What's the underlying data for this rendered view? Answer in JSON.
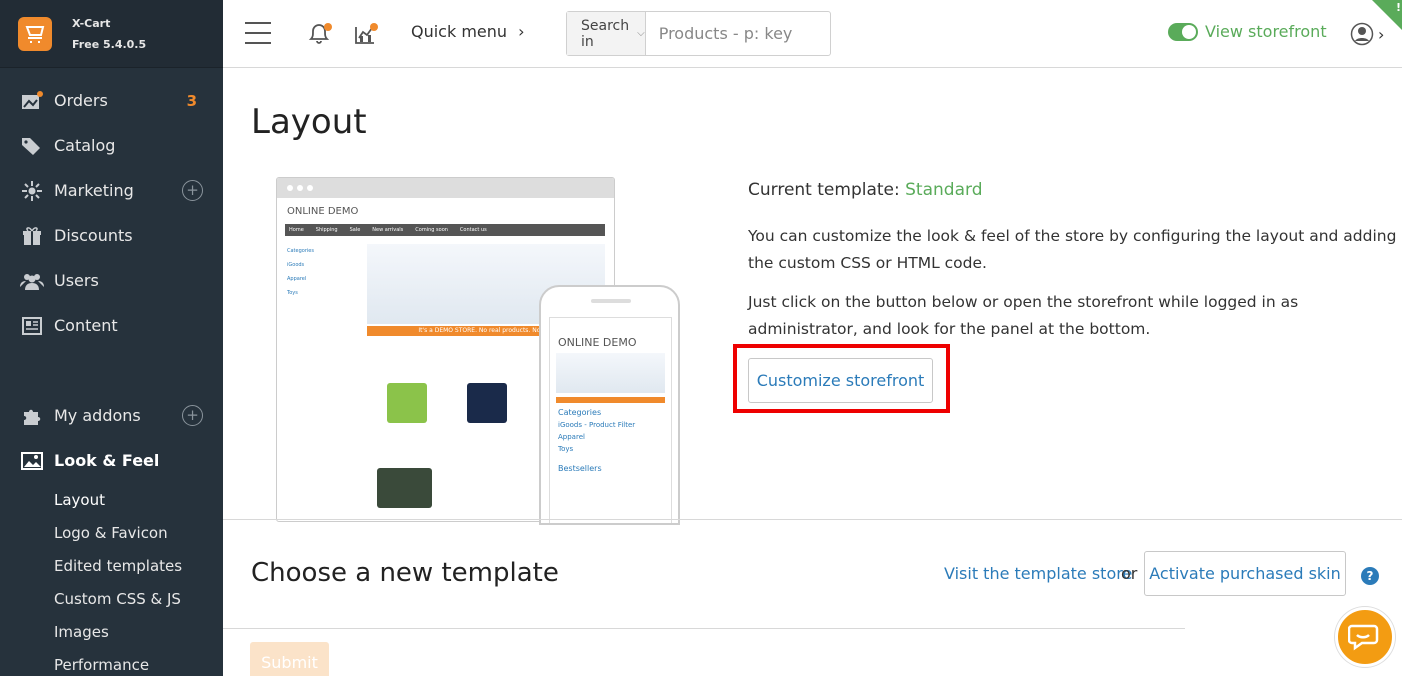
{
  "brand": {
    "name": "X-Cart",
    "version": "Free 5.4.0.5"
  },
  "sidebar": {
    "items": [
      {
        "label": "Orders",
        "badge": "3",
        "icon": "orders-icon"
      },
      {
        "label": "Catalog",
        "icon": "tag-icon"
      },
      {
        "label": "Marketing",
        "icon": "marketing-icon"
      },
      {
        "label": "Discounts",
        "icon": "gift-icon"
      },
      {
        "label": "Users",
        "icon": "users-icon"
      },
      {
        "label": "Content",
        "icon": "content-icon"
      },
      {
        "label": "My addons",
        "icon": "puzzle-icon"
      },
      {
        "label": "Look & Feel",
        "icon": "image-icon"
      }
    ],
    "sub_items": [
      "Layout",
      "Logo & Favicon",
      "Edited templates",
      "Custom CSS & JS",
      "Images",
      "Performance"
    ]
  },
  "topbar": {
    "quick_menu": "Quick menu",
    "search_in": "Search in",
    "search_placeholder": "Products - p: key",
    "view_storefront": "View storefront"
  },
  "main": {
    "title": "Layout",
    "current_template_label": "Current template:",
    "current_template_value": "Standard",
    "desc1": "You can customize the look & feel of the store by configuring the layout and adding the custom CSS or HTML code.",
    "desc2": "Just click on the button below or open the storefront while logged in as administrator, and look for the panel at the bottom.",
    "customize_button": "Customize storefront",
    "choose_title": "Choose a new template",
    "visit_link": "Visit the template store",
    "or": "or",
    "activate_button": "Activate purchased skin",
    "submit": "Submit"
  },
  "preview": {
    "desktop_logo": "ONLINE DEMO",
    "nav": [
      "Home",
      "Shipping",
      "Sale",
      "New arrivals",
      "Coming soon",
      "Contact us"
    ],
    "categories": [
      "Categories",
      "iGoods",
      "Apparel",
      "Toys"
    ],
    "strip": "It's a DEMO STORE. No real products. No real",
    "phone_logo": "ONLINE DEMO",
    "phone_categories": [
      "Categories",
      "iGoods - Product Filter",
      "Apparel",
      "Toys",
      "Bestsellers"
    ]
  },
  "colors": {
    "accent": "#f08a2c",
    "link": "#2b7bb9",
    "green": "#5aab5a",
    "sidebar": "#26323c",
    "highlight": "#ee0000"
  }
}
